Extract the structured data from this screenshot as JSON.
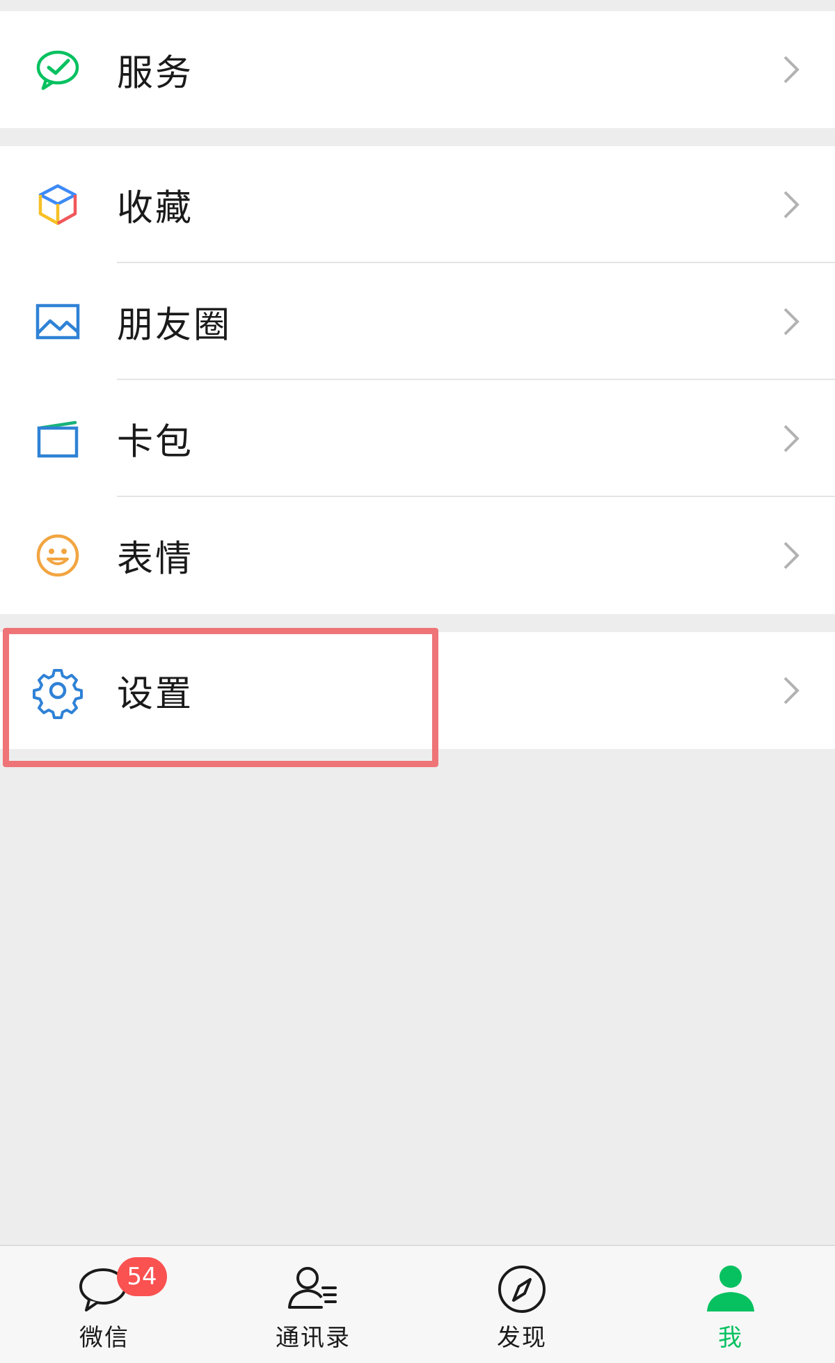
{
  "menu": {
    "services": {
      "label": "服务",
      "icon": "services-check-icon"
    },
    "favorites": {
      "label": "收藏",
      "icon": "favorites-cube-icon"
    },
    "moments": {
      "label": "朋友圈",
      "icon": "moments-photo-icon"
    },
    "cards": {
      "label": "卡包",
      "icon": "card-wallet-icon"
    },
    "stickers": {
      "label": "表情",
      "icon": "smiley-icon"
    },
    "settings": {
      "label": "设置",
      "icon": "gear-icon"
    }
  },
  "tabbar": {
    "chats": {
      "label": "微信",
      "badge": "54",
      "icon": "chat-bubble-icon"
    },
    "contacts": {
      "label": "通讯录",
      "icon": "contacts-icon"
    },
    "discover": {
      "label": "发现",
      "icon": "compass-icon"
    },
    "me": {
      "label": "我",
      "icon": "person-icon",
      "active": true
    }
  },
  "colors": {
    "accent_green": "#07c160",
    "badge_red": "#fa5151",
    "highlight_red": "#ee7477",
    "background": "#ededed"
  }
}
